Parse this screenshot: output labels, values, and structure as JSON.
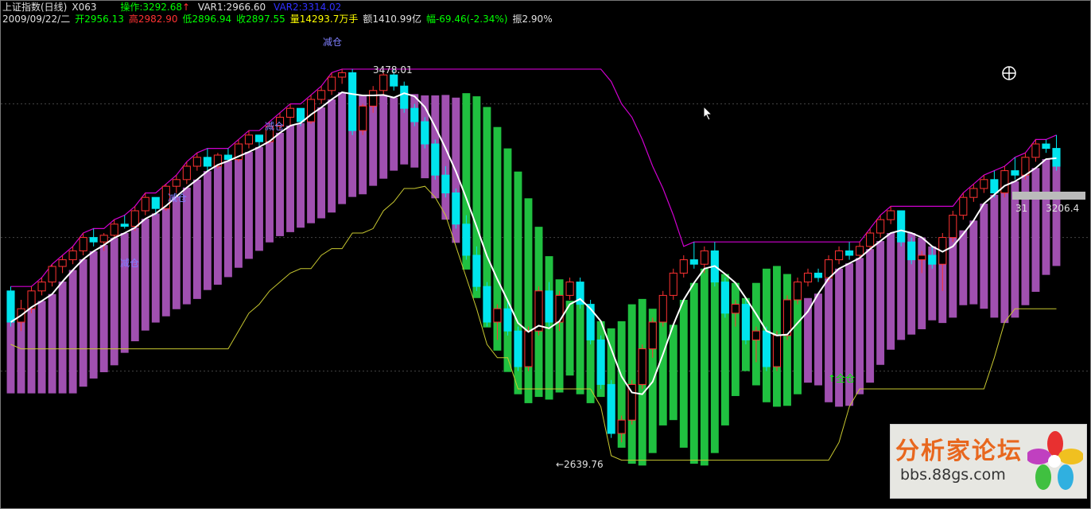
{
  "header": {
    "title": "上证指数(日线)",
    "formula": "X063",
    "op_label": "操作:3292.68",
    "op_arrow": "↑",
    "var1": "VAR1:2966.60",
    "var2": "VAR2:3314.02",
    "date": "2009/09/22/二",
    "open": "开2956.13",
    "high": "高2982.90",
    "low": "低2896.94",
    "close": "收2897.55",
    "volume": "量14293.7万手",
    "amount": "额1410.99亿",
    "change": "幅-69.46(-2.34%)",
    "amplitude": "振2.90%"
  },
  "annotations": {
    "reduce1": "减仓",
    "reduce2": "减仓",
    "reduce3": "减仓",
    "reduce4": "减仓",
    "full": "↑全仓",
    "peak": "3478.01",
    "trough": "←2639.76",
    "right_label": "31      3206.4"
  },
  "watermark": {
    "title": "分析家论坛",
    "url": "bbs.88gs.com"
  },
  "colors": {
    "up": "#ff3232",
    "down": "#00e5ee",
    "ma": "#ffffff",
    "purple_band": "#a050b0",
    "green_band": "#20c040",
    "stop_line": "#d000d0",
    "support_line": "#c8c830",
    "label_blue": "#8080ff",
    "label_green": "#00ff00"
  },
  "chart_data": {
    "type": "candlestick",
    "ylim": [
      2560,
      3560
    ],
    "peak_value": 3478.01,
    "trough_value": 2639.76,
    "candles": [
      [
        2980,
        2990,
        2900,
        2910
      ],
      [
        2910,
        2960,
        2890,
        2940
      ],
      [
        2940,
        2990,
        2930,
        2980
      ],
      [
        2980,
        3010,
        2970,
        3000
      ],
      [
        3000,
        3040,
        2990,
        3035
      ],
      [
        3035,
        3060,
        3020,
        3050
      ],
      [
        3050,
        3080,
        3040,
        3070
      ],
      [
        3070,
        3110,
        3060,
        3100
      ],
      [
        3100,
        3120,
        3080,
        3090
      ],
      [
        3090,
        3110,
        3070,
        3105
      ],
      [
        3105,
        3140,
        3100,
        3130
      ],
      [
        3130,
        3150,
        3120,
        3125
      ],
      [
        3125,
        3170,
        3115,
        3160
      ],
      [
        3160,
        3200,
        3150,
        3190
      ],
      [
        3190,
        3185,
        3150,
        3165
      ],
      [
        3165,
        3220,
        3160,
        3215
      ],
      [
        3215,
        3240,
        3200,
        3230
      ],
      [
        3230,
        3270,
        3220,
        3260
      ],
      [
        3260,
        3290,
        3250,
        3280
      ],
      [
        3280,
        3300,
        3250,
        3260
      ],
      [
        3260,
        3290,
        3255,
        3285
      ],
      [
        3285,
        3300,
        3270,
        3275
      ],
      [
        3275,
        3320,
        3270,
        3310
      ],
      [
        3310,
        3340,
        3300,
        3330
      ],
      [
        3330,
        3330,
        3305,
        3315
      ],
      [
        3315,
        3360,
        3310,
        3350
      ],
      [
        3350,
        3380,
        3340,
        3370
      ],
      [
        3370,
        3400,
        3350,
        3390
      ],
      [
        3390,
        3390,
        3350,
        3360
      ],
      [
        3360,
        3420,
        3355,
        3410
      ],
      [
        3410,
        3440,
        3400,
        3430
      ],
      [
        3430,
        3470,
        3420,
        3460
      ],
      [
        3460,
        3478,
        3445,
        3470
      ],
      [
        3470,
        3478,
        3330,
        3340
      ],
      [
        3340,
        3400,
        3330,
        3395
      ],
      [
        3395,
        3440,
        3380,
        3430
      ],
      [
        3430,
        3470,
        3420,
        3465
      ],
      [
        3465,
        3478,
        3430,
        3440
      ],
      [
        3440,
        3450,
        3380,
        3390
      ],
      [
        3390,
        3400,
        3350,
        3360
      ],
      [
        3360,
        3370,
        3300,
        3310
      ],
      [
        3310,
        3320,
        3230,
        3240
      ],
      [
        3240,
        3260,
        3190,
        3200
      ],
      [
        3200,
        3210,
        3120,
        3130
      ],
      [
        3130,
        3150,
        3050,
        3060
      ],
      [
        3060,
        3080,
        2980,
        2990
      ],
      [
        2990,
        3000,
        2900,
        2910
      ],
      [
        2910,
        2950,
        2870,
        2940
      ],
      [
        2940,
        2960,
        2880,
        2890
      ],
      [
        2890,
        2900,
        2800,
        2810
      ],
      [
        2810,
        2900,
        2800,
        2890
      ],
      [
        2890,
        2990,
        2880,
        2980
      ],
      [
        2980,
        3000,
        2900,
        2910
      ],
      [
        2910,
        2980,
        2890,
        2970
      ],
      [
        2970,
        3010,
        2960,
        3000
      ],
      [
        3000,
        3010,
        2940,
        2950
      ],
      [
        2950,
        2960,
        2860,
        2870
      ],
      [
        2870,
        2880,
        2760,
        2770
      ],
      [
        2770,
        2780,
        2650,
        2660
      ],
      [
        2660,
        2700,
        2640,
        2690
      ],
      [
        2690,
        2780,
        2680,
        2770
      ],
      [
        2770,
        2860,
        2760,
        2850
      ],
      [
        2850,
        2920,
        2830,
        2910
      ],
      [
        2910,
        2980,
        2900,
        2970
      ],
      [
        2970,
        3030,
        2960,
        3020
      ],
      [
        3020,
        3060,
        3010,
        3050
      ],
      [
        3050,
        3090,
        3030,
        3040
      ],
      [
        3040,
        3080,
        3020,
        3070
      ],
      [
        3070,
        3090,
        2990,
        3000
      ],
      [
        3000,
        3010,
        2920,
        2930
      ],
      [
        2930,
        2960,
        2900,
        2950
      ],
      [
        2950,
        2960,
        2860,
        2870
      ],
      [
        2870,
        2900,
        2820,
        2890
      ],
      [
        2890,
        2900,
        2800,
        2810
      ],
      [
        2810,
        2890,
        2800,
        2880
      ],
      [
        2880,
        2970,
        2870,
        2960
      ],
      [
        2960,
        3010,
        2950,
        3000
      ],
      [
        3000,
        3030,
        2990,
        3020
      ],
      [
        3020,
        3030,
        3000,
        3010
      ],
      [
        3010,
        3060,
        3000,
        3050
      ],
      [
        3050,
        3080,
        3040,
        3070
      ],
      [
        3070,
        3090,
        3050,
        3060
      ],
      [
        3060,
        3090,
        3050,
        3080
      ],
      [
        3080,
        3120,
        3070,
        3110
      ],
      [
        3110,
        3150,
        3100,
        3140
      ],
      [
        3140,
        3170,
        3130,
        3160
      ],
      [
        3160,
        3160,
        3080,
        3090
      ],
      [
        3090,
        3100,
        3040,
        3050
      ],
      [
        3050,
        3070,
        3020,
        3060
      ],
      [
        3060,
        3080,
        3030,
        3040
      ],
      [
        3040,
        3110,
        2980,
        3100
      ],
      [
        3100,
        3160,
        3090,
        3150
      ],
      [
        3150,
        3200,
        3140,
        3190
      ],
      [
        3190,
        3220,
        3180,
        3210
      ],
      [
        3210,
        3240,
        3200,
        3230
      ],
      [
        3230,
        3250,
        3190,
        3200
      ],
      [
        3200,
        3260,
        3190,
        3250
      ],
      [
        3250,
        3280,
        3230,
        3240
      ],
      [
        3240,
        3290,
        3230,
        3280
      ],
      [
        3280,
        3320,
        3270,
        3310
      ],
      [
        3310,
        3320,
        3290,
        3300
      ],
      [
        3300,
        3330,
        3250,
        3260
      ]
    ]
  }
}
